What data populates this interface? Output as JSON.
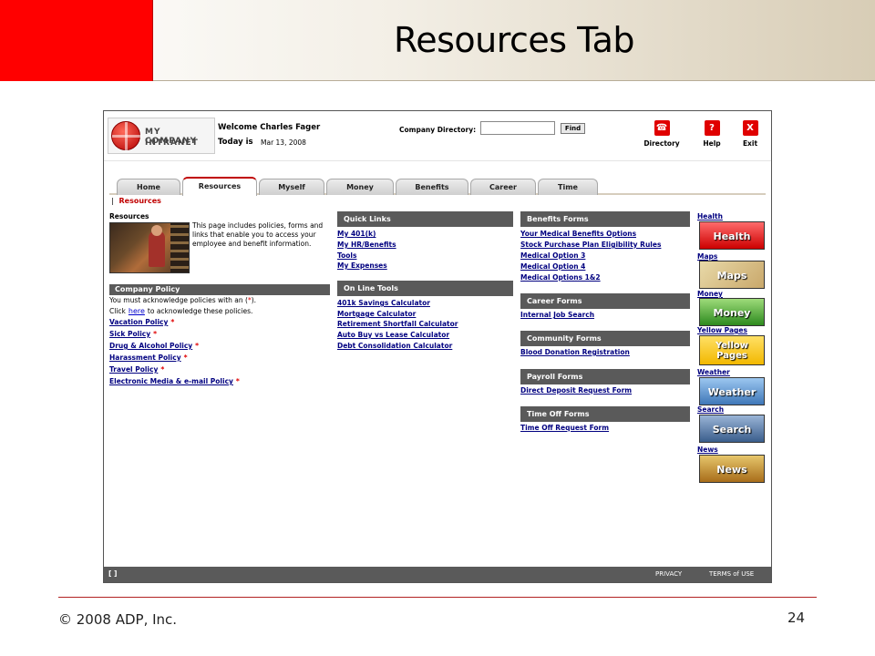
{
  "slide": {
    "title": "Resources Tab",
    "footer_copyright": "© 2008 ADP, Inc.",
    "page_number": "24",
    "accent_color": "#ff0000"
  },
  "header": {
    "logo_line1": "MY COMPANY",
    "logo_line2": "INTRANET",
    "welcome_text": "Welcome Charles Fager",
    "today_label": "Today is",
    "today_date": "Mar 13, 2008",
    "directory_label": "Company Directory:",
    "directory_value": "",
    "find_label": "Find",
    "tools": [
      {
        "label": "Directory",
        "icon": "phone-icon",
        "glyph": "☎"
      },
      {
        "label": "Help",
        "icon": "help-icon",
        "glyph": "?"
      },
      {
        "label": "Exit",
        "icon": "close-icon",
        "glyph": "X"
      }
    ]
  },
  "tabs": [
    {
      "label": "Home"
    },
    {
      "label": "Resources",
      "active": true
    },
    {
      "label": "Myself"
    },
    {
      "label": "Money"
    },
    {
      "label": "Benefits"
    },
    {
      "label": "Career"
    },
    {
      "label": "Time"
    }
  ],
  "breadcrumb": {
    "separator": "|",
    "current": "Resources"
  },
  "resources": {
    "heading": "Resources",
    "description": "This page includes policies, forms and links that enable you to access your employee and benefit information."
  },
  "company_policy": {
    "header": "Company Policy",
    "note1_prefix": "You must acknowledge policies with an (",
    "note1_star": "*",
    "note1_suffix": ").",
    "note2_prefix": "Click",
    "here_link": "here",
    "note2_suffix": "to acknowledge these policies.",
    "star": "*",
    "links": [
      "Vacation Policy",
      "Sick Policy",
      "Drug & Alcohol Policy",
      "Harassment Policy",
      "Travel Policy",
      "Electronic Media & e-mail Policy"
    ]
  },
  "quick_links": {
    "header": "Quick Links",
    "links": [
      "My 401(k)",
      "My HR/Benefits",
      "Tools",
      "My Expenses"
    ]
  },
  "online_tools": {
    "header": "On Line Tools",
    "links": [
      "401k Savings Calculator",
      "Mortgage Calculator",
      "Retirement Shortfall Calculator",
      "Auto Buy vs Lease Calculator",
      "Debt Consolidation Calculator"
    ]
  },
  "benefits_forms": {
    "header": "Benefits Forms",
    "links": [
      "Your Medical Benefits Options",
      "Stock Purchase Plan Eligibility Rules",
      "Medical Option 3",
      "Medical Option 4",
      "Medical Options 1&2"
    ]
  },
  "career_forms": {
    "header": "Career Forms",
    "links": [
      "Internal Job Search"
    ]
  },
  "community_forms": {
    "header": "Community Forms",
    "links": [
      "Blood Donation Registration"
    ]
  },
  "payroll_forms": {
    "header": "Payroll Forms",
    "links": [
      "Direct Deposit Request Form"
    ]
  },
  "timeoff_forms": {
    "header": "Time Off Forms",
    "links": [
      "Time Off Request Form"
    ]
  },
  "side_links": [
    {
      "label": "Health",
      "icon_text": "Health"
    },
    {
      "label": "Maps",
      "icon_text": "Maps"
    },
    {
      "label": "Money",
      "icon_text": "Money"
    },
    {
      "label": "Yellow Pages",
      "icon_text_1": "Yellow",
      "icon_text_2": "Pages"
    },
    {
      "label": "Weather",
      "icon_text": "Weather"
    },
    {
      "label": "Search",
      "icon_text": "Search"
    },
    {
      "label": "News",
      "icon_text": "News"
    }
  ],
  "status_bar": {
    "left_text": "[ ]",
    "privacy": "PRIVACY",
    "terms": "TERMS of USE"
  }
}
